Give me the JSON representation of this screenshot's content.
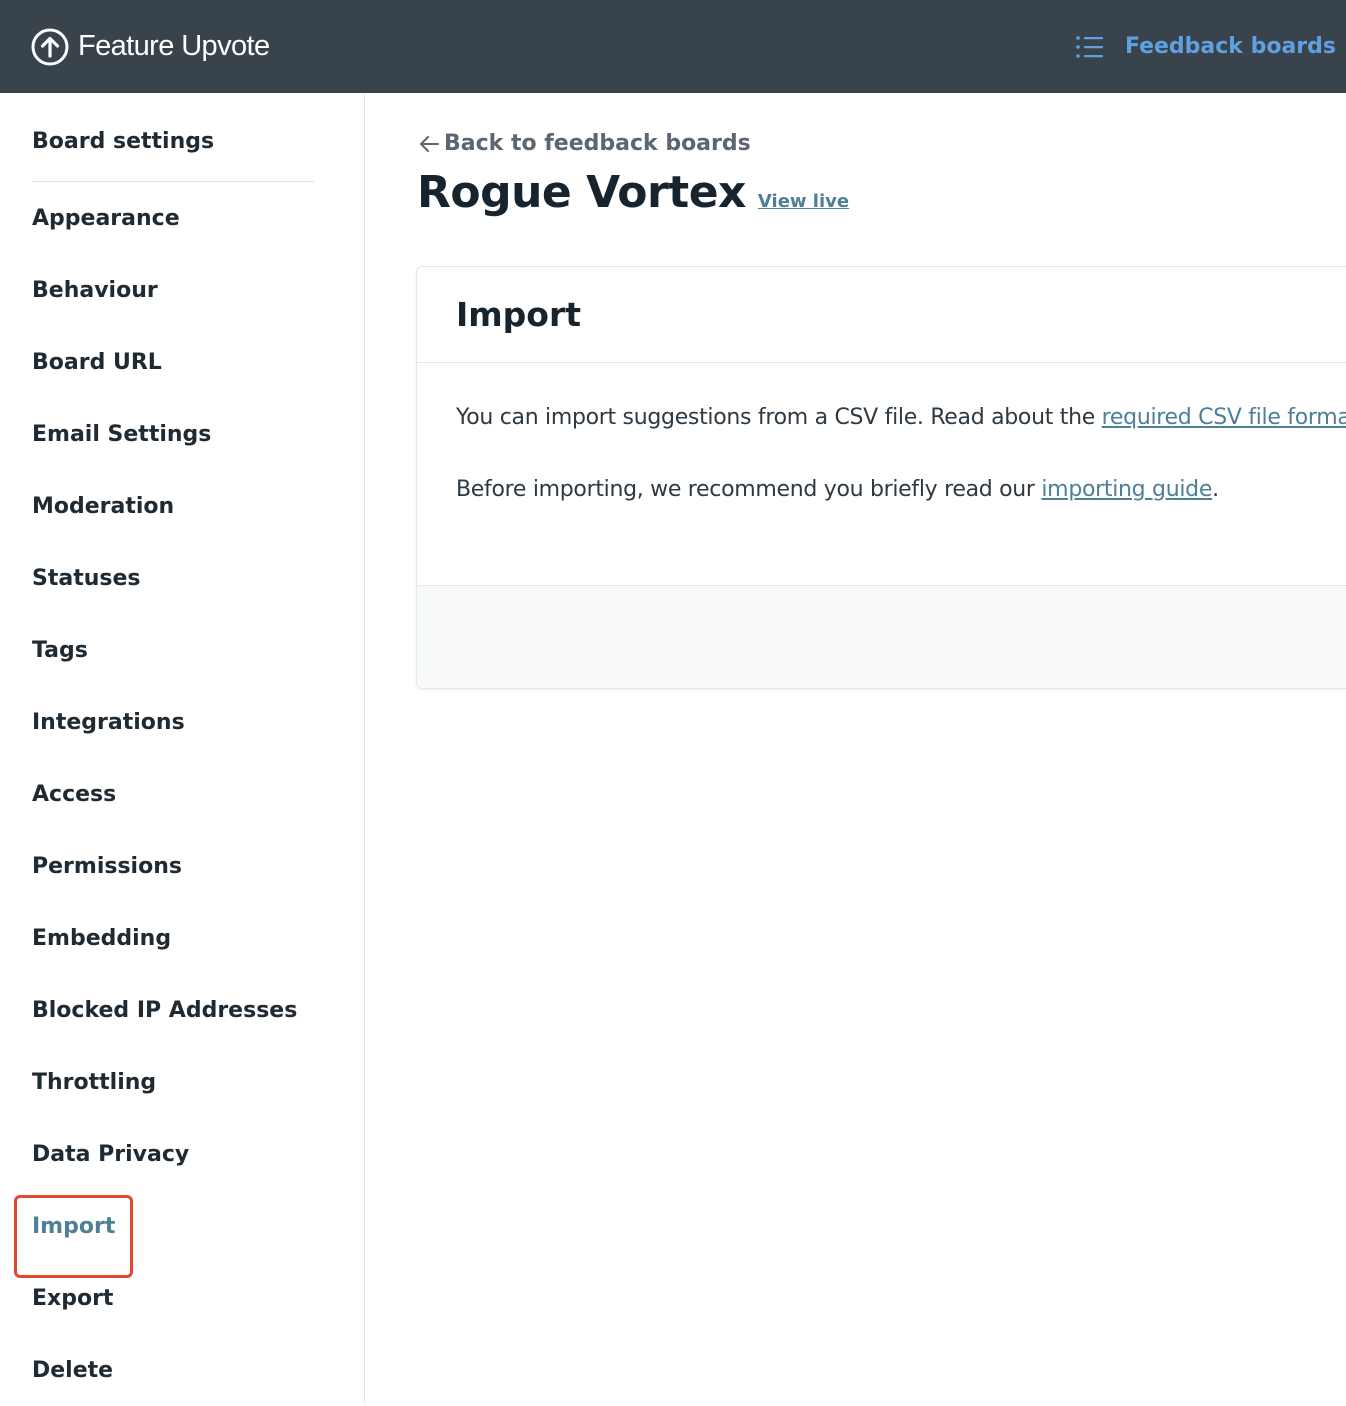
{
  "header": {
    "brand_name": "Feature Upvote",
    "brand_icon": "upvote-arrow-circle-icon",
    "nav_icon": "list-icon",
    "nav_link_label": "Feedback boards"
  },
  "sidebar": {
    "heading": "Board settings",
    "active_item": "Import",
    "items": [
      {
        "label": "Appearance"
      },
      {
        "label": "Behaviour"
      },
      {
        "label": "Board URL"
      },
      {
        "label": "Email Settings"
      },
      {
        "label": "Moderation"
      },
      {
        "label": "Statuses"
      },
      {
        "label": "Tags"
      },
      {
        "label": "Integrations"
      },
      {
        "label": "Access"
      },
      {
        "label": "Permissions"
      },
      {
        "label": "Embedding"
      },
      {
        "label": "Blocked IP Addresses"
      },
      {
        "label": "Throttling"
      },
      {
        "label": "Data Privacy"
      },
      {
        "label": "Import"
      },
      {
        "label": "Export"
      },
      {
        "label": "Delete"
      }
    ]
  },
  "main": {
    "back_link": "Back to feedback boards",
    "back_icon": "arrow-left-icon",
    "board_title": "Rogue Vortex",
    "view_live_label": "View live",
    "card": {
      "title": "Import",
      "line1_prefix": "You can import suggestions from a CSV file. Read about the ",
      "line1_link": "required CSV file format",
      "line1_suffix": ".",
      "line2_prefix": "Before importing, we recommend you briefly read our ",
      "line2_link": "importing guide",
      "line2_suffix": "."
    }
  },
  "colors": {
    "topbar_bg": "#38434c",
    "nav_link": "#5fa1e0",
    "accent_link": "#4d7f96",
    "active_highlight_border": "#e0492f",
    "text_dark": "#1f2a33"
  }
}
